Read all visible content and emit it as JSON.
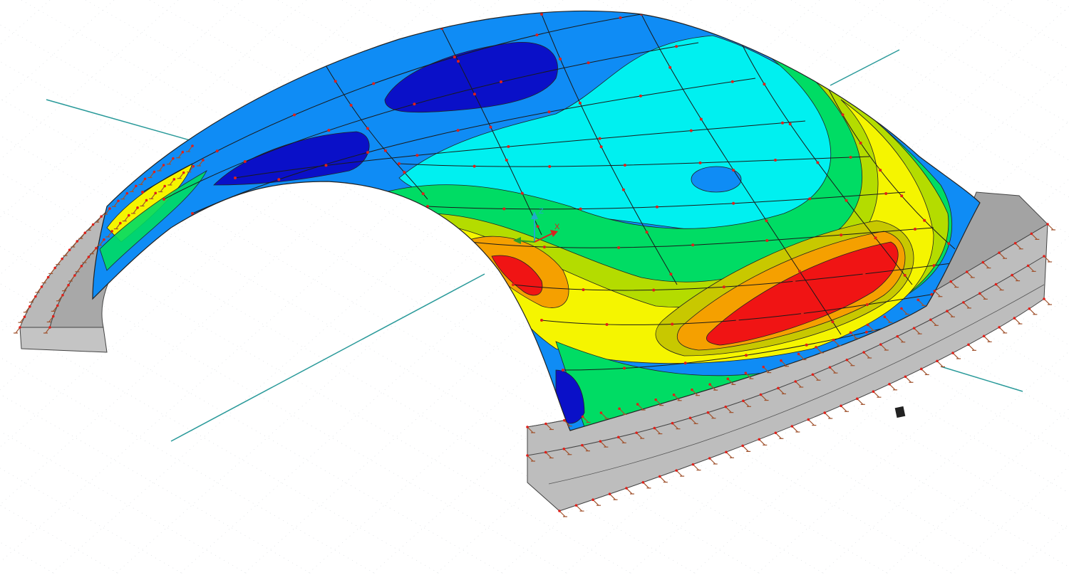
{
  "viewport": {
    "background": "#ffffff",
    "grid_color": "#d9dde0",
    "guide_line_color": "#2a9a9a",
    "node_color": "#e0201a",
    "support_color": "#a0522d",
    "wall_fill": "#b9b9b9",
    "wall_top_fill": "#9e9e9e",
    "wall_edge": "#444444"
  },
  "coordinate_system": {
    "x_label": "X",
    "y_label": "Y",
    "z_label": "Z",
    "x_color": "#d9231f",
    "y_color": "#2aa02a",
    "z_color": "#22aacc"
  },
  "contour_palette": [
    "#0a10c8",
    "#0c1ef0",
    "#0f8cf5",
    "#00f0f0",
    "#00dc64",
    "#32c832",
    "#b4dc00",
    "#f5f500",
    "#c8c800",
    "#f5a000",
    "#f06400",
    "#f01414"
  ],
  "icons": {
    "coordinate_system": "axis-triad-icon",
    "support": "support-symbol-icon",
    "node": "fe-node-icon"
  }
}
